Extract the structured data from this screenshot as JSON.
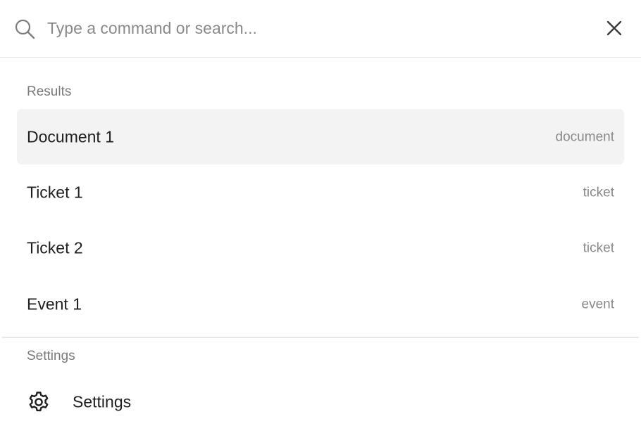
{
  "search": {
    "value": "",
    "placeholder": "Type a command or search..."
  },
  "icons": {
    "search": "search-icon",
    "close": "close-icon",
    "settings": "gear-icon"
  },
  "sections": {
    "results": {
      "label": "Results",
      "items": [
        {
          "title": "Document 1",
          "type": "document",
          "active": true
        },
        {
          "title": "Ticket 1",
          "type": "ticket",
          "active": false
        },
        {
          "title": "Ticket 2",
          "type": "ticket",
          "active": false
        },
        {
          "title": "Event 1",
          "type": "event",
          "active": false
        }
      ]
    },
    "settings": {
      "label": "Settings",
      "items": [
        {
          "title": "Settings",
          "icon": "gear-icon"
        }
      ]
    }
  },
  "colors": {
    "active_row_bg": "#f3f3f3",
    "muted_text": "#8a8a8a",
    "primary_text": "#1f1f1f",
    "divider": "#e5e5e5"
  }
}
